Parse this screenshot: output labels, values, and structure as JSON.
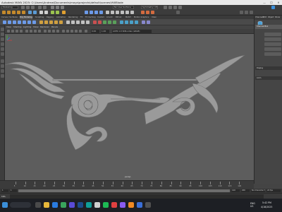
{
  "window": {
    "title": "Autodesk MAYA 2025: C:\\Users\\Andrew\\Documents\\maya\\projects\\default\\scenes\\HWBlade",
    "minimize": "—",
    "maximize": "☐",
    "close": "✕"
  },
  "menubar": {
    "workspace_field": "Modeling",
    "live_surface": "No Live Surface",
    "symmetry": "Symmetry: Off"
  },
  "shelf": {
    "tabs": [
      "Curves / Surfaces",
      "Poly Modeling",
      "Sculpting",
      "Rigging",
      "Animation",
      "Rendering",
      "FX",
      "FX Caching",
      "Custom",
      "Arnold",
      "Bifrost",
      "MASH",
      "Motion Graphics",
      "XGen"
    ],
    "active_tab": 1
  },
  "panel": {
    "menus": [
      "View",
      "Shading",
      "Lighting",
      "Show",
      "Renderer",
      "Panels"
    ],
    "near_field": "0.00",
    "far_field": "1.00",
    "colorspace": "ACES 1.0 SDR-video (sRGB)"
  },
  "viewport": {
    "camera_label": "persp"
  },
  "right_panel": {
    "tabs": [
      "Channels",
      "Edit",
      "Object",
      "Show"
    ],
    "header": "Channel Box",
    "buttons": [
      "",
      "",
      "",
      "",
      ""
    ],
    "sections": [
      "Display",
      "Anim"
    ]
  },
  "timeslider": {
    "ticks": [
      "5",
      "10",
      "15",
      "20",
      "25",
      "30",
      "35",
      "40",
      "45",
      "50",
      "55",
      "60",
      "65",
      "70",
      "75",
      "80",
      "85",
      "90",
      "95",
      "100",
      "105",
      "110",
      "115",
      "120"
    ],
    "current_frame": "1"
  },
  "rangeslider": {
    "start": "1",
    "play_start": "1",
    "play_end": "120",
    "end": "200",
    "character_set": "No Character Set",
    "anim_layer": "No Anim Layer",
    "fps": "24 fps"
  },
  "commandline": {
    "label": "MEL"
  },
  "taskbar": {
    "time": "5:42 PM",
    "date": "4/18/2025",
    "lang": "ENG\nUS"
  },
  "colors": {
    "accent": "#3b8fd9",
    "viewport_bg": "#5d5d5d",
    "model": "#9a9a9a"
  }
}
